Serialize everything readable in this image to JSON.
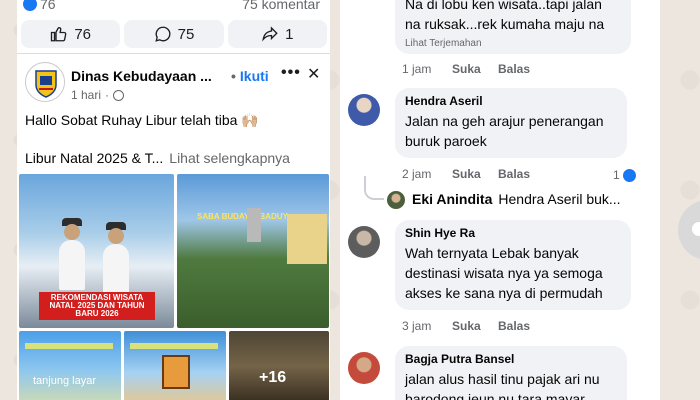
{
  "post": {
    "top_likes": "76",
    "top_comments": "75 komentar",
    "actions": {
      "like_count": "76",
      "comment_count": "75",
      "share_count": "1"
    },
    "page_name": "Dinas Kebudayaan ...",
    "follow_label": "Ikuti",
    "time": "1 hari",
    "line1": "Hallo Sobat Ruhay Libur telah tiba 🙌🏼",
    "line2": "Libur Natal 2025 & T...",
    "see_more": "Lihat selengkapnya",
    "photo1_banner": "REKOMENDASI WISATA NATAL 2025 DAN TAHUN BARU 2026",
    "photo2_title": "SABA BUDAY & BADUY",
    "photo3_label": "tanjung layar",
    "photo5_more": "+16"
  },
  "comments": [
    {
      "author": "",
      "text": "Na di lobu ken wisata..tapi jalan na ruksak...rek kumaha maju na",
      "translate": "Lihat Terjemahan",
      "time": "1 jam",
      "like": "Suka",
      "reply": "Balas"
    },
    {
      "author": "Hendra Aseril",
      "text": "Jalan na geh arajur penerangan buruk paroek",
      "time": "2 jam",
      "like": "Suka",
      "reply": "Balas",
      "reactions": "1"
    },
    {
      "author": "Eki Anindita",
      "text": "Hendra Aseril buk..."
    },
    {
      "author": "Shin Hye Ra",
      "text": "Wah ternyata Lebak banyak destinasi wisata nya ya semoga akses ke sana nya di permudah",
      "time": "3 jam",
      "like": "Suka",
      "reply": "Balas"
    },
    {
      "author": "Bagja Putra Bansel",
      "text": "jalan alus hasil tinu pajak ari nu barodong ieun nu tara mayar"
    }
  ],
  "colors": {
    "accent": "#1877f2",
    "bubble": "#f0f2f5",
    "muted": "#65676b"
  }
}
